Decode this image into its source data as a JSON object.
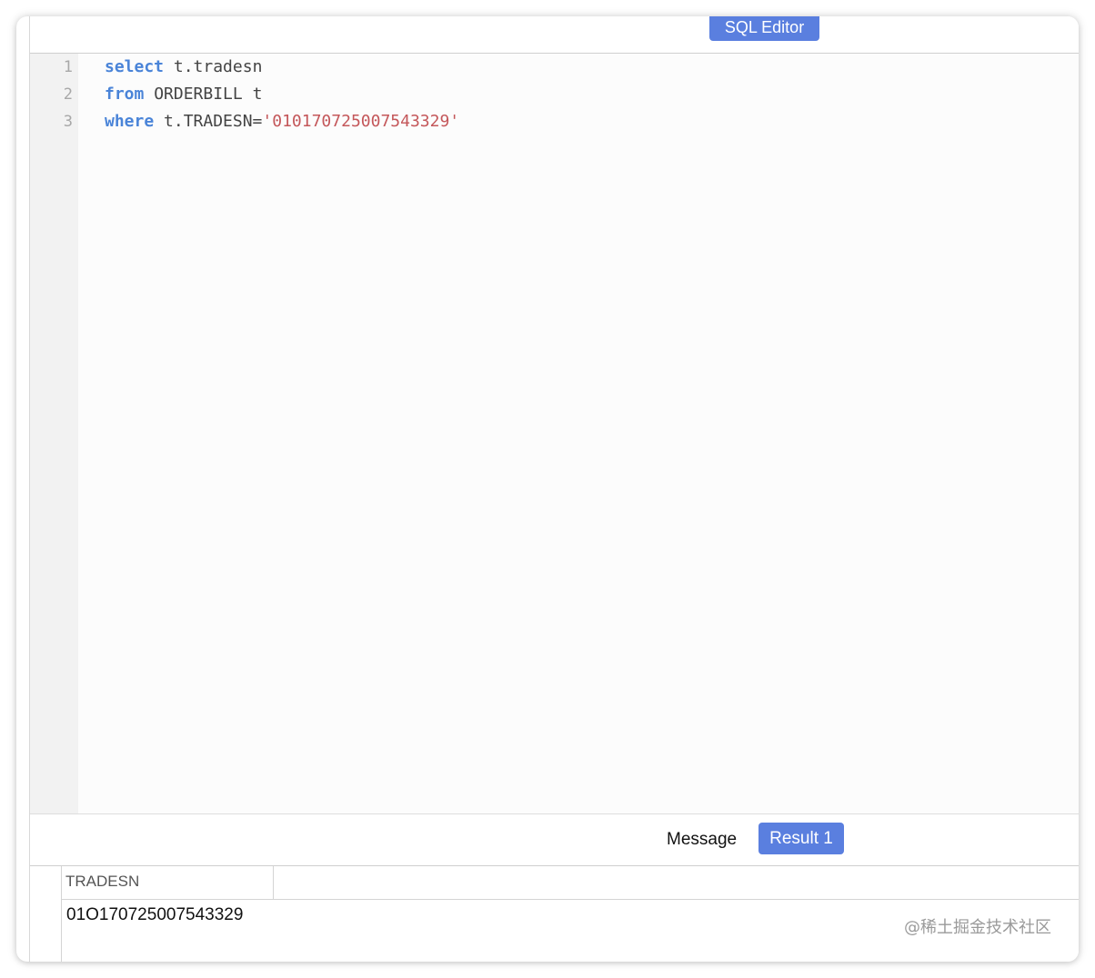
{
  "window": {
    "title": "SQL Editor"
  },
  "editor": {
    "lines": [
      {
        "number": "1",
        "keyword": "select",
        "rest": " t.tradesn",
        "string": ""
      },
      {
        "number": "2",
        "keyword": "from",
        "rest": " ORDERBILL t",
        "string": ""
      },
      {
        "number": "3",
        "keyword": "where",
        "rest": " t.TRADESN=",
        "string": "'010170725007543329'"
      }
    ]
  },
  "results": {
    "tabs": {
      "message": "Message",
      "result": "Result 1"
    },
    "columns": [
      "TRADESN"
    ],
    "rows": [
      [
        "01O170725007543329"
      ]
    ]
  },
  "watermark": "@稀土掘金技术社区",
  "colors": {
    "accent": "#5a7fdf",
    "keyword": "#4a84d8",
    "string": "#c4575a"
  }
}
